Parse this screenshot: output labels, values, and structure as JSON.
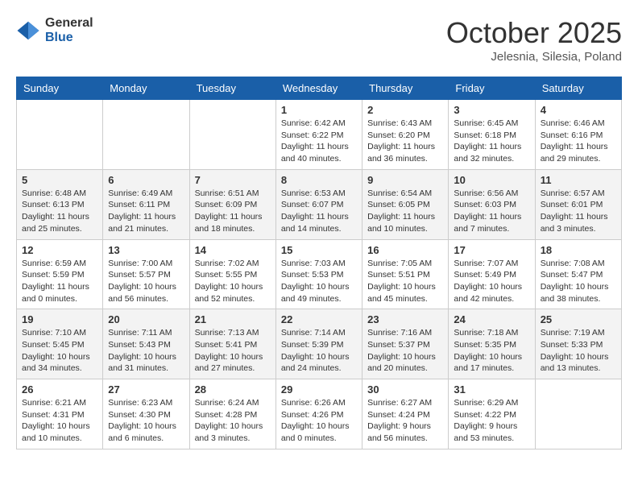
{
  "header": {
    "logo_general": "General",
    "logo_blue": "Blue",
    "month": "October 2025",
    "location": "Jelesnia, Silesia, Poland"
  },
  "days_of_week": [
    "Sunday",
    "Monday",
    "Tuesday",
    "Wednesday",
    "Thursday",
    "Friday",
    "Saturday"
  ],
  "weeks": [
    [
      {
        "day": "",
        "info": ""
      },
      {
        "day": "",
        "info": ""
      },
      {
        "day": "",
        "info": ""
      },
      {
        "day": "1",
        "info": "Sunrise: 6:42 AM\nSunset: 6:22 PM\nDaylight: 11 hours\nand 40 minutes."
      },
      {
        "day": "2",
        "info": "Sunrise: 6:43 AM\nSunset: 6:20 PM\nDaylight: 11 hours\nand 36 minutes."
      },
      {
        "day": "3",
        "info": "Sunrise: 6:45 AM\nSunset: 6:18 PM\nDaylight: 11 hours\nand 32 minutes."
      },
      {
        "day": "4",
        "info": "Sunrise: 6:46 AM\nSunset: 6:16 PM\nDaylight: 11 hours\nand 29 minutes."
      }
    ],
    [
      {
        "day": "5",
        "info": "Sunrise: 6:48 AM\nSunset: 6:13 PM\nDaylight: 11 hours\nand 25 minutes."
      },
      {
        "day": "6",
        "info": "Sunrise: 6:49 AM\nSunset: 6:11 PM\nDaylight: 11 hours\nand 21 minutes."
      },
      {
        "day": "7",
        "info": "Sunrise: 6:51 AM\nSunset: 6:09 PM\nDaylight: 11 hours\nand 18 minutes."
      },
      {
        "day": "8",
        "info": "Sunrise: 6:53 AM\nSunset: 6:07 PM\nDaylight: 11 hours\nand 14 minutes."
      },
      {
        "day": "9",
        "info": "Sunrise: 6:54 AM\nSunset: 6:05 PM\nDaylight: 11 hours\nand 10 minutes."
      },
      {
        "day": "10",
        "info": "Sunrise: 6:56 AM\nSunset: 6:03 PM\nDaylight: 11 hours\nand 7 minutes."
      },
      {
        "day": "11",
        "info": "Sunrise: 6:57 AM\nSunset: 6:01 PM\nDaylight: 11 hours\nand 3 minutes."
      }
    ],
    [
      {
        "day": "12",
        "info": "Sunrise: 6:59 AM\nSunset: 5:59 PM\nDaylight: 11 hours\nand 0 minutes."
      },
      {
        "day": "13",
        "info": "Sunrise: 7:00 AM\nSunset: 5:57 PM\nDaylight: 10 hours\nand 56 minutes."
      },
      {
        "day": "14",
        "info": "Sunrise: 7:02 AM\nSunset: 5:55 PM\nDaylight: 10 hours\nand 52 minutes."
      },
      {
        "day": "15",
        "info": "Sunrise: 7:03 AM\nSunset: 5:53 PM\nDaylight: 10 hours\nand 49 minutes."
      },
      {
        "day": "16",
        "info": "Sunrise: 7:05 AM\nSunset: 5:51 PM\nDaylight: 10 hours\nand 45 minutes."
      },
      {
        "day": "17",
        "info": "Sunrise: 7:07 AM\nSunset: 5:49 PM\nDaylight: 10 hours\nand 42 minutes."
      },
      {
        "day": "18",
        "info": "Sunrise: 7:08 AM\nSunset: 5:47 PM\nDaylight: 10 hours\nand 38 minutes."
      }
    ],
    [
      {
        "day": "19",
        "info": "Sunrise: 7:10 AM\nSunset: 5:45 PM\nDaylight: 10 hours\nand 34 minutes."
      },
      {
        "day": "20",
        "info": "Sunrise: 7:11 AM\nSunset: 5:43 PM\nDaylight: 10 hours\nand 31 minutes."
      },
      {
        "day": "21",
        "info": "Sunrise: 7:13 AM\nSunset: 5:41 PM\nDaylight: 10 hours\nand 27 minutes."
      },
      {
        "day": "22",
        "info": "Sunrise: 7:14 AM\nSunset: 5:39 PM\nDaylight: 10 hours\nand 24 minutes."
      },
      {
        "day": "23",
        "info": "Sunrise: 7:16 AM\nSunset: 5:37 PM\nDaylight: 10 hours\nand 20 minutes."
      },
      {
        "day": "24",
        "info": "Sunrise: 7:18 AM\nSunset: 5:35 PM\nDaylight: 10 hours\nand 17 minutes."
      },
      {
        "day": "25",
        "info": "Sunrise: 7:19 AM\nSunset: 5:33 PM\nDaylight: 10 hours\nand 13 minutes."
      }
    ],
    [
      {
        "day": "26",
        "info": "Sunrise: 6:21 AM\nSunset: 4:31 PM\nDaylight: 10 hours\nand 10 minutes."
      },
      {
        "day": "27",
        "info": "Sunrise: 6:23 AM\nSunset: 4:30 PM\nDaylight: 10 hours\nand 6 minutes."
      },
      {
        "day": "28",
        "info": "Sunrise: 6:24 AM\nSunset: 4:28 PM\nDaylight: 10 hours\nand 3 minutes."
      },
      {
        "day": "29",
        "info": "Sunrise: 6:26 AM\nSunset: 4:26 PM\nDaylight: 10 hours\nand 0 minutes."
      },
      {
        "day": "30",
        "info": "Sunrise: 6:27 AM\nSunset: 4:24 PM\nDaylight: 9 hours\nand 56 minutes."
      },
      {
        "day": "31",
        "info": "Sunrise: 6:29 AM\nSunset: 4:22 PM\nDaylight: 9 hours\nand 53 minutes."
      },
      {
        "day": "",
        "info": ""
      }
    ]
  ]
}
